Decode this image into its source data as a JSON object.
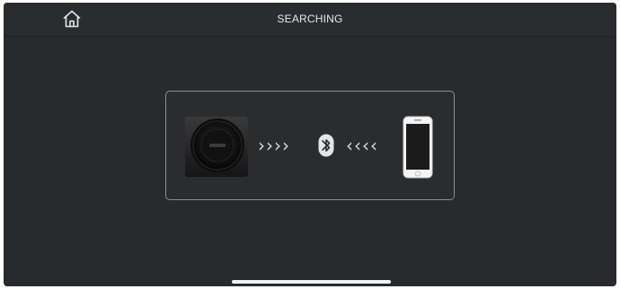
{
  "header": {
    "title": "SEARCHING",
    "home_icon": "home-icon"
  },
  "pairing": {
    "arrows_to_center": "››››",
    "arrows_from_phone": "‹‹‹‹",
    "device_icon": "speaker-icon",
    "connection_icon": "bluetooth-icon",
    "target_icon": "smartphone-icon"
  },
  "colors": {
    "background": "#282b2d",
    "panel_border": "#8a8e92",
    "text": "#e8e8e8"
  }
}
